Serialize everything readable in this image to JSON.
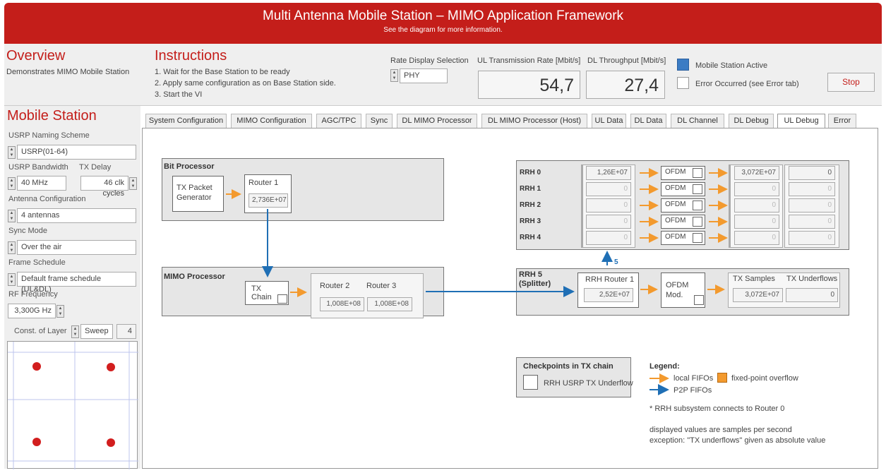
{
  "header": {
    "title": "Multi Antenna Mobile Station – MIMO Application Framework",
    "subtitle": "See the diagram for more information."
  },
  "overview": {
    "title": "Overview",
    "text": "Demonstrates MIMO Mobile Station"
  },
  "instructions": {
    "title": "Instructions",
    "steps": [
      "1. Wait for the Base Station to be ready",
      "2. Apply same configuration as on Base Station side.",
      "3. Start the VI"
    ]
  },
  "rate_display": {
    "label": "Rate Display Selection",
    "value": "PHY"
  },
  "ul_rate": {
    "label": "UL Transmission Rate [Mbit/s]",
    "value": "54,7"
  },
  "dl_rate": {
    "label": "DL Throughput [Mbit/s]",
    "value": "27,4"
  },
  "status": {
    "active_label": "Mobile Station Active",
    "error_label": "Error Occurred (see Error tab)"
  },
  "stop_label": "Stop",
  "colors": {
    "brand": "#c41e1a",
    "local_fifo": "#f39a2e",
    "p2p_fifo": "#1f6fb5",
    "active_led": "#3b7cc4"
  },
  "mobile": {
    "title": "Mobile Station",
    "naming_label": "USRP Naming Scheme",
    "naming_value": "USRP(01-64)",
    "bw_label": "USRP Bandwidth",
    "bw_value": "40 MHz",
    "txd_label": "TX Delay",
    "txd_value": "46 clk cycles",
    "ant_label": "Antenna Configuration",
    "ant_value": "4 antennas",
    "sync_label": "Sync Mode",
    "sync_value": "Over the air",
    "frame_label": "Frame Schedule",
    "frame_value": "Default frame schedule (UL&DL)",
    "rf_label": "RF Frequency",
    "rf_value": "3,300G Hz",
    "const_label": "Const. of Layer",
    "const_mode": "Sweep",
    "const_num": "4"
  },
  "tabs": [
    "System Configuration",
    "MIMO Configuration",
    "AGC/TPC",
    "Sync",
    "DL MIMO Processor",
    "DL MIMO Processor (Host)",
    "UL Data",
    "DL Data",
    "DL Channel",
    "DL Debug",
    "UL Debug",
    "Error"
  ],
  "diagram": {
    "bit_processor": {
      "title": "Bit Processor",
      "gen": "TX Packet Generator",
      "router": "Router 1",
      "router_val": "2,736E+07"
    },
    "mimo_processor": {
      "title": "MIMO Processor",
      "chain": "TX Chain",
      "r2": "Router 2",
      "r3": "Router 3",
      "r2_val": "1,008E+08",
      "r3_val": "1,008E+08"
    },
    "rrh_rows": [
      {
        "name": "RRH 0",
        "in": "1,26E+07",
        "ofdm": "OFDM",
        "out": "3,072E+07",
        "uf": "0"
      },
      {
        "name": "RRH 1",
        "in": "0",
        "ofdm": "OFDM",
        "out": "0",
        "uf": "0"
      },
      {
        "name": "RRH 2",
        "in": "0",
        "ofdm": "OFDM",
        "out": "0",
        "uf": "0"
      },
      {
        "name": "RRH 3",
        "in": "0",
        "ofdm": "OFDM",
        "out": "0",
        "uf": "0"
      },
      {
        "name": "RRH 4",
        "in": "0",
        "ofdm": "OFDM",
        "out": "0",
        "uf": "0"
      }
    ],
    "rrh5": {
      "title": "RRH 5 (Splitter)",
      "router": "RRH Router 1",
      "router_val": "2,52E+07",
      "ofdm": "OFDM Mod.",
      "samples_label": "TX Samples",
      "samples_val": "3,072E+07",
      "uf_label": "TX Underflows",
      "uf_val": "0"
    },
    "split_count": "5",
    "checkpoints": {
      "title": "Checkpoints in TX chain",
      "item": "RRH USRP TX Underflow"
    },
    "legend": {
      "title": "Legend:",
      "local": "local FIFOs",
      "p2p": "P2P FIFOs",
      "overflow": "fixed-point overflow",
      "note1": "* RRH subsystem connects to Router 0",
      "note2": "displayed values are samples per second",
      "note3": "exception: \"TX underflows\" given as absolute value"
    }
  }
}
